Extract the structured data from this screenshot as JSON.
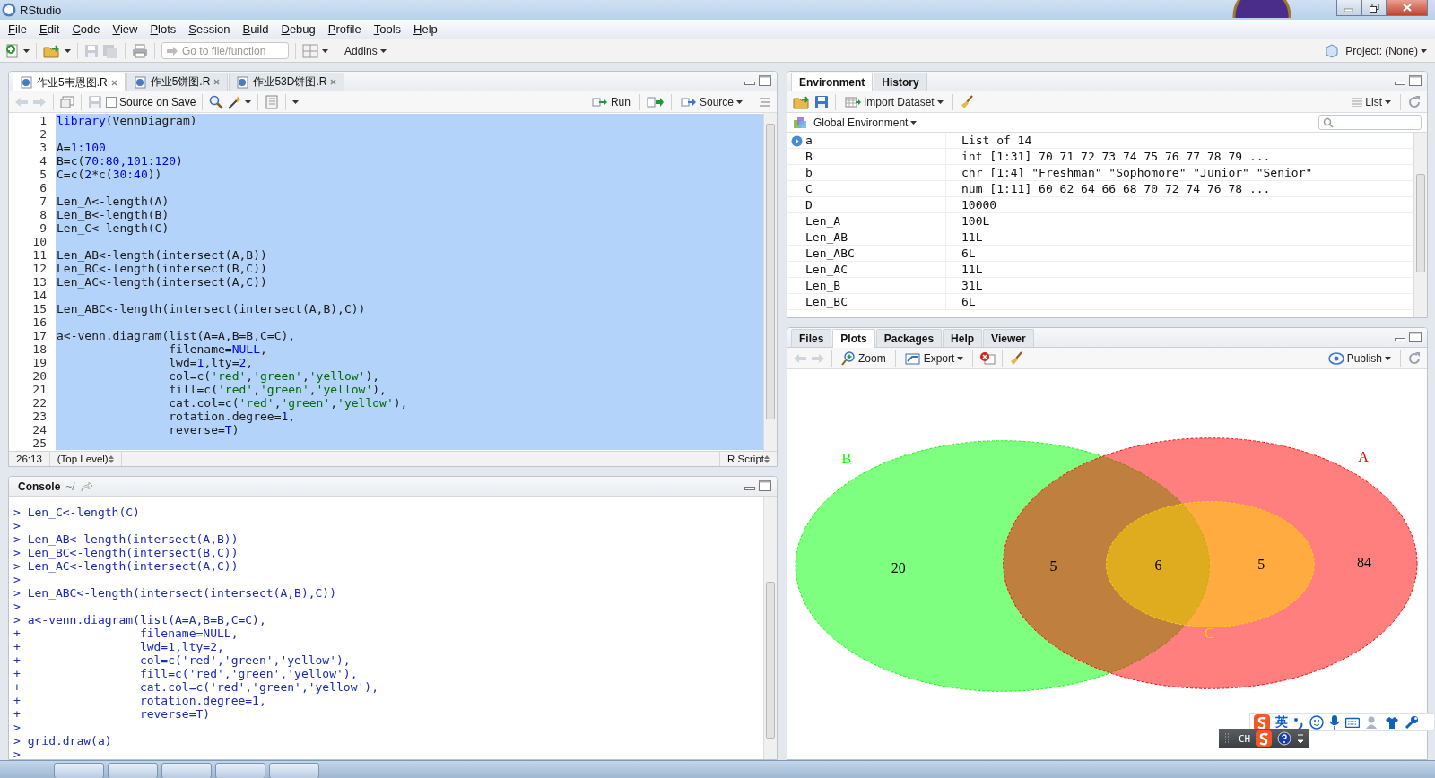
{
  "window": {
    "title": "RStudio"
  },
  "menu": [
    "File",
    "Edit",
    "Code",
    "View",
    "Plots",
    "Session",
    "Build",
    "Debug",
    "Profile",
    "Tools",
    "Help"
  ],
  "toolbar": {
    "goto_placeholder": "Go to file/function",
    "addins": "Addins",
    "project": "Project: (None)"
  },
  "editor": {
    "tabs": [
      {
        "label": "作业5韦恩图.R",
        "selected": true
      },
      {
        "label": "作业5饼图.R",
        "selected": false
      },
      {
        "label": "作业53D饼图.R",
        "selected": false
      }
    ],
    "source_on_save": {
      "label": "Source on Save",
      "checked": false
    },
    "run": "Run",
    "source": "Source",
    "lines": [
      {
        "number": "1",
        "selected": true,
        "tokens": [
          {
            "text": "library",
            "kind": "keyword"
          },
          {
            "text": "(VennDiagram)",
            "kind": "plain"
          }
        ]
      },
      {
        "number": "2",
        "selected": true
      },
      {
        "number": "3",
        "selected": true,
        "tokens": [
          {
            "text": "A=",
            "kind": "plain"
          },
          {
            "text": "1:100",
            "kind": "number"
          }
        ]
      },
      {
        "number": "4",
        "selected": true,
        "tokens": [
          {
            "text": "B=c(",
            "kind": "plain"
          },
          {
            "text": "70:80,101:120",
            "kind": "number"
          },
          {
            "text": ")",
            "kind": "plain"
          }
        ]
      },
      {
        "number": "5",
        "selected": true,
        "tokens": [
          {
            "text": "C=c(",
            "kind": "plain"
          },
          {
            "text": "2",
            "kind": "number"
          },
          {
            "text": "*c(",
            "kind": "plain"
          },
          {
            "text": "30:40",
            "kind": "number"
          },
          {
            "text": "))",
            "kind": "plain"
          }
        ]
      },
      {
        "number": "6",
        "selected": true
      },
      {
        "number": "7",
        "selected": true,
        "tokens": [
          {
            "text": "Len_A<-length(A)",
            "kind": "plain"
          }
        ]
      },
      {
        "number": "8",
        "selected": true,
        "tokens": [
          {
            "text": "Len_B<-length(B)",
            "kind": "plain"
          }
        ]
      },
      {
        "number": "9",
        "selected": true,
        "tokens": [
          {
            "text": "Len_C<-length(C)",
            "kind": "plain"
          }
        ]
      },
      {
        "number": "10",
        "selected": true
      },
      {
        "number": "11",
        "selected": true,
        "tokens": [
          {
            "text": "Len_AB<-length(intersect(A,B))",
            "kind": "plain"
          }
        ]
      },
      {
        "number": "12",
        "selected": true,
        "tokens": [
          {
            "text": "Len_BC<-length(intersect(B,C))",
            "kind": "plain"
          }
        ]
      },
      {
        "number": "13",
        "selected": true,
        "tokens": [
          {
            "text": "Len_AC<-length(intersect(A,C))",
            "kind": "plain"
          }
        ]
      },
      {
        "number": "14",
        "selected": true
      },
      {
        "number": "15",
        "selected": true,
        "tokens": [
          {
            "text": "Len_ABC<-length(intersect(intersect(A,B),C))",
            "kind": "plain"
          }
        ]
      },
      {
        "number": "16",
        "selected": true
      },
      {
        "number": "17",
        "selected": true,
        "tokens": [
          {
            "text": "a<-venn.diagram(list(A=A,B=B,C=C),",
            "kind": "plain"
          }
        ]
      },
      {
        "number": "18",
        "selected": true,
        "tokens": [
          {
            "text": "                filename=",
            "kind": "plain"
          },
          {
            "text": "NULL",
            "kind": "keyword"
          },
          {
            "text": ",",
            "kind": "plain"
          }
        ]
      },
      {
        "number": "19",
        "selected": true,
        "tokens": [
          {
            "text": "                lwd=",
            "kind": "plain"
          },
          {
            "text": "1",
            "kind": "number"
          },
          {
            "text": ",lty=",
            "kind": "plain"
          },
          {
            "text": "2",
            "kind": "number"
          },
          {
            "text": ",",
            "kind": "plain"
          }
        ]
      },
      {
        "number": "20",
        "selected": true,
        "tokens": [
          {
            "text": "                col=c(",
            "kind": "plain"
          },
          {
            "text": "'red'",
            "kind": "string"
          },
          {
            "text": ",",
            "kind": "plain"
          },
          {
            "text": "'green'",
            "kind": "string"
          },
          {
            "text": ",",
            "kind": "plain"
          },
          {
            "text": "'yellow'",
            "kind": "string"
          },
          {
            "text": "),",
            "kind": "plain"
          }
        ]
      },
      {
        "number": "21",
        "selected": true,
        "tokens": [
          {
            "text": "                fill=c(",
            "kind": "plain"
          },
          {
            "text": "'red'",
            "kind": "string"
          },
          {
            "text": ",",
            "kind": "plain"
          },
          {
            "text": "'green'",
            "kind": "string"
          },
          {
            "text": ",",
            "kind": "plain"
          },
          {
            "text": "'yellow'",
            "kind": "string"
          },
          {
            "text": "),",
            "kind": "plain"
          }
        ]
      },
      {
        "number": "22",
        "selected": true,
        "tokens": [
          {
            "text": "                cat.col=c(",
            "kind": "plain"
          },
          {
            "text": "'red'",
            "kind": "string"
          },
          {
            "text": ",",
            "kind": "plain"
          },
          {
            "text": "'green'",
            "kind": "string"
          },
          {
            "text": ",",
            "kind": "plain"
          },
          {
            "text": "'yellow'",
            "kind": "string"
          },
          {
            "text": "),",
            "kind": "plain"
          }
        ]
      },
      {
        "number": "23",
        "selected": true,
        "tokens": [
          {
            "text": "                rotation.degree=",
            "kind": "plain"
          },
          {
            "text": "1",
            "kind": "number"
          },
          {
            "text": ",",
            "kind": "plain"
          }
        ]
      },
      {
        "number": "24",
        "selected": true,
        "tokens": [
          {
            "text": "                reverse=",
            "kind": "plain"
          },
          {
            "text": "T",
            "kind": "keyword"
          },
          {
            "text": ")",
            "kind": "plain"
          }
        ]
      },
      {
        "number": "25",
        "selected": true
      }
    ],
    "status": {
      "position": "26:13",
      "scope": "(Top Level)",
      "file_type": "R Script"
    }
  },
  "console": {
    "title": "Console",
    "path": "~/",
    "lines": [
      "> Len_C<-length(C)",
      ">",
      "> Len_AB<-length(intersect(A,B))",
      "> Len_BC<-length(intersect(B,C))",
      "> Len_AC<-length(intersect(A,C))",
      ">",
      "> Len_ABC<-length(intersect(intersect(A,B),C))",
      ">",
      "> a<-venn.diagram(list(A=A,B=B,C=C),",
      "+                 filename=NULL,",
      "+                 lwd=1,lty=2,",
      "+                 col=c('red','green','yellow'),",
      "+                 fill=c('red','green','yellow'),",
      "+                 cat.col=c('red','green','yellow'),",
      "+                 rotation.degree=1,",
      "+                 reverse=T)",
      ">",
      "> grid.draw(a)",
      ">"
    ]
  },
  "environment": {
    "tabs": [
      {
        "label": "Environment",
        "selected": true
      },
      {
        "label": "History",
        "selected": false
      }
    ],
    "import": "Import Dataset",
    "view": "List",
    "scope": "Global Environment",
    "rows": [
      {
        "name": "a",
        "value": "List of 14",
        "expandable": true
      },
      {
        "name": "B",
        "value": "int [1:31] 70 71 72 73 74 75 76 77 78 79 ...",
        "expandable": false
      },
      {
        "name": "b",
        "value": "chr [1:4] \"Freshman\" \"Sophomore\" \"Junior\" \"Senior\"",
        "expandable": false
      },
      {
        "name": "C",
        "value": "num [1:11] 60 62 64 66 68 70 72 74 76 78 ...",
        "expandable": false
      },
      {
        "name": "D",
        "value": "10000",
        "expandable": false
      },
      {
        "name": "Len_A",
        "value": "100L",
        "expandable": false
      },
      {
        "name": "Len_AB",
        "value": "11L",
        "expandable": false
      },
      {
        "name": "Len_ABC",
        "value": "6L",
        "expandable": false
      },
      {
        "name": "Len_AC",
        "value": "11L",
        "expandable": false
      },
      {
        "name": "Len_B",
        "value": "31L",
        "expandable": false
      },
      {
        "name": "Len_BC",
        "value": "6L",
        "expandable": false
      }
    ]
  },
  "plots_pane": {
    "tabs": [
      {
        "label": "Files",
        "selected": false
      },
      {
        "label": "Plots",
        "selected": true
      },
      {
        "label": "Packages",
        "selected": false
      },
      {
        "label": "Help",
        "selected": false
      },
      {
        "label": "Viewer",
        "selected": false
      }
    ],
    "zoom": "Zoom",
    "export": "Export",
    "publish": "Publish",
    "venn": {
      "sets": [
        {
          "label": "A",
          "color": "#ff0000"
        },
        {
          "label": "B",
          "color": "#00ff00"
        },
        {
          "label": "C",
          "color": "#ffd700"
        }
      ],
      "region_counts": [
        "20",
        "5",
        "6",
        "5",
        "84"
      ]
    }
  },
  "ime": {
    "language": "英",
    "mode": "CH"
  }
}
